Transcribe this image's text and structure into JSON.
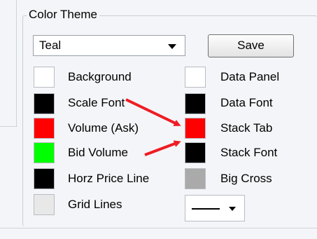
{
  "group_title": "Color Theme",
  "theme_select": {
    "selected": "Teal"
  },
  "save_label": "Save",
  "left_items": [
    {
      "label": "Background",
      "color": "#ffffff"
    },
    {
      "label": "Scale Font",
      "color": "#000000"
    },
    {
      "label": "Volume (Ask)",
      "color": "#ff0000"
    },
    {
      "label": "Bid Volume",
      "color": "#00ff00"
    },
    {
      "label": "Horz Price Line",
      "color": "#000000"
    },
    {
      "label": "Grid Lines",
      "color": "#e8e8e8"
    }
  ],
  "right_items": [
    {
      "label": "Data Panel",
      "color": "#ffffff"
    },
    {
      "label": "Data Font",
      "color": "#000000"
    },
    {
      "label": "Stack Tab",
      "color": "#ff0000"
    },
    {
      "label": "Stack Font",
      "color": "#000000"
    },
    {
      "label": "Big Cross",
      "color": "#aaaaaa"
    }
  ],
  "line_style_icon": "solid-line",
  "annotation_color": "#ee1c24"
}
